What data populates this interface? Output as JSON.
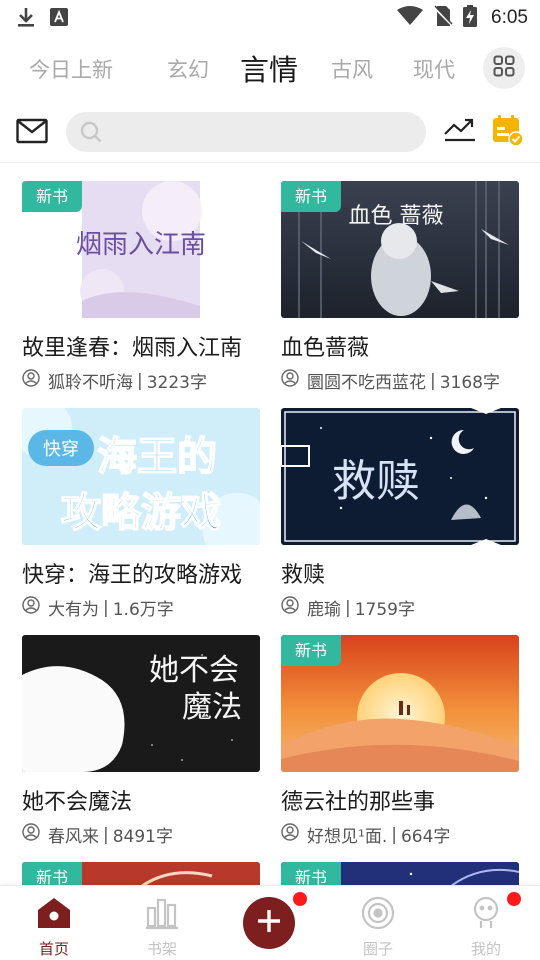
{
  "status_bar": {
    "time": "6:05"
  },
  "tabs": [
    {
      "label": "今日上新",
      "active": false
    },
    {
      "label": "玄幻",
      "active": false
    },
    {
      "label": "言情",
      "active": true
    },
    {
      "label": "古风",
      "active": false
    },
    {
      "label": "现代",
      "active": false
    }
  ],
  "search": {
    "placeholder": ""
  },
  "badge_label": "新书",
  "books": [
    {
      "title": "故里逢春：烟雨入江南",
      "author": "狐聆不听海",
      "words": "3223字",
      "new": true,
      "cover_text": "烟雨入江南"
    },
    {
      "title": "血色蔷薇",
      "author": "圜圆不吃西蓝花",
      "words": "3168字",
      "new": true,
      "cover_text": "血色 蔷薇"
    },
    {
      "title": "快穿：海王的攻略游戏",
      "author": "大有为",
      "words": "1.6万字",
      "new": false,
      "cover_text": "海王的攻略游戏"
    },
    {
      "title": "救赎",
      "author": "鹿瑜",
      "words": "1759字",
      "new": false,
      "cover_text": "救赎"
    },
    {
      "title": "她不会魔法",
      "author": "春风来",
      "words": "8491字",
      "new": false,
      "cover_text": "她不会魔法"
    },
    {
      "title": "德云社的那些事",
      "author": "好想见¹面.",
      "words": "664字",
      "new": true,
      "cover_text": ""
    }
  ],
  "bottom_nav": [
    {
      "label": "首页",
      "active": true
    },
    {
      "label": "书架",
      "active": false
    },
    {
      "label": "圈子",
      "active": false
    },
    {
      "label": "我的",
      "active": false
    }
  ],
  "colors": {
    "accent": "#7e1f1f",
    "badge": "#33b8a0",
    "notification": "#ff1a1a",
    "calendar": "#f5b400"
  },
  "icons": [
    "download-icon",
    "app-icon",
    "wifi-icon",
    "no-sim-icon",
    "battery-charging-icon",
    "grid-icon",
    "mail-icon",
    "search-icon",
    "trend-icon",
    "calendar-check-icon",
    "author-icon",
    "home-icon",
    "bookshelf-icon",
    "plus-icon",
    "circle-icon",
    "profile-icon"
  ]
}
